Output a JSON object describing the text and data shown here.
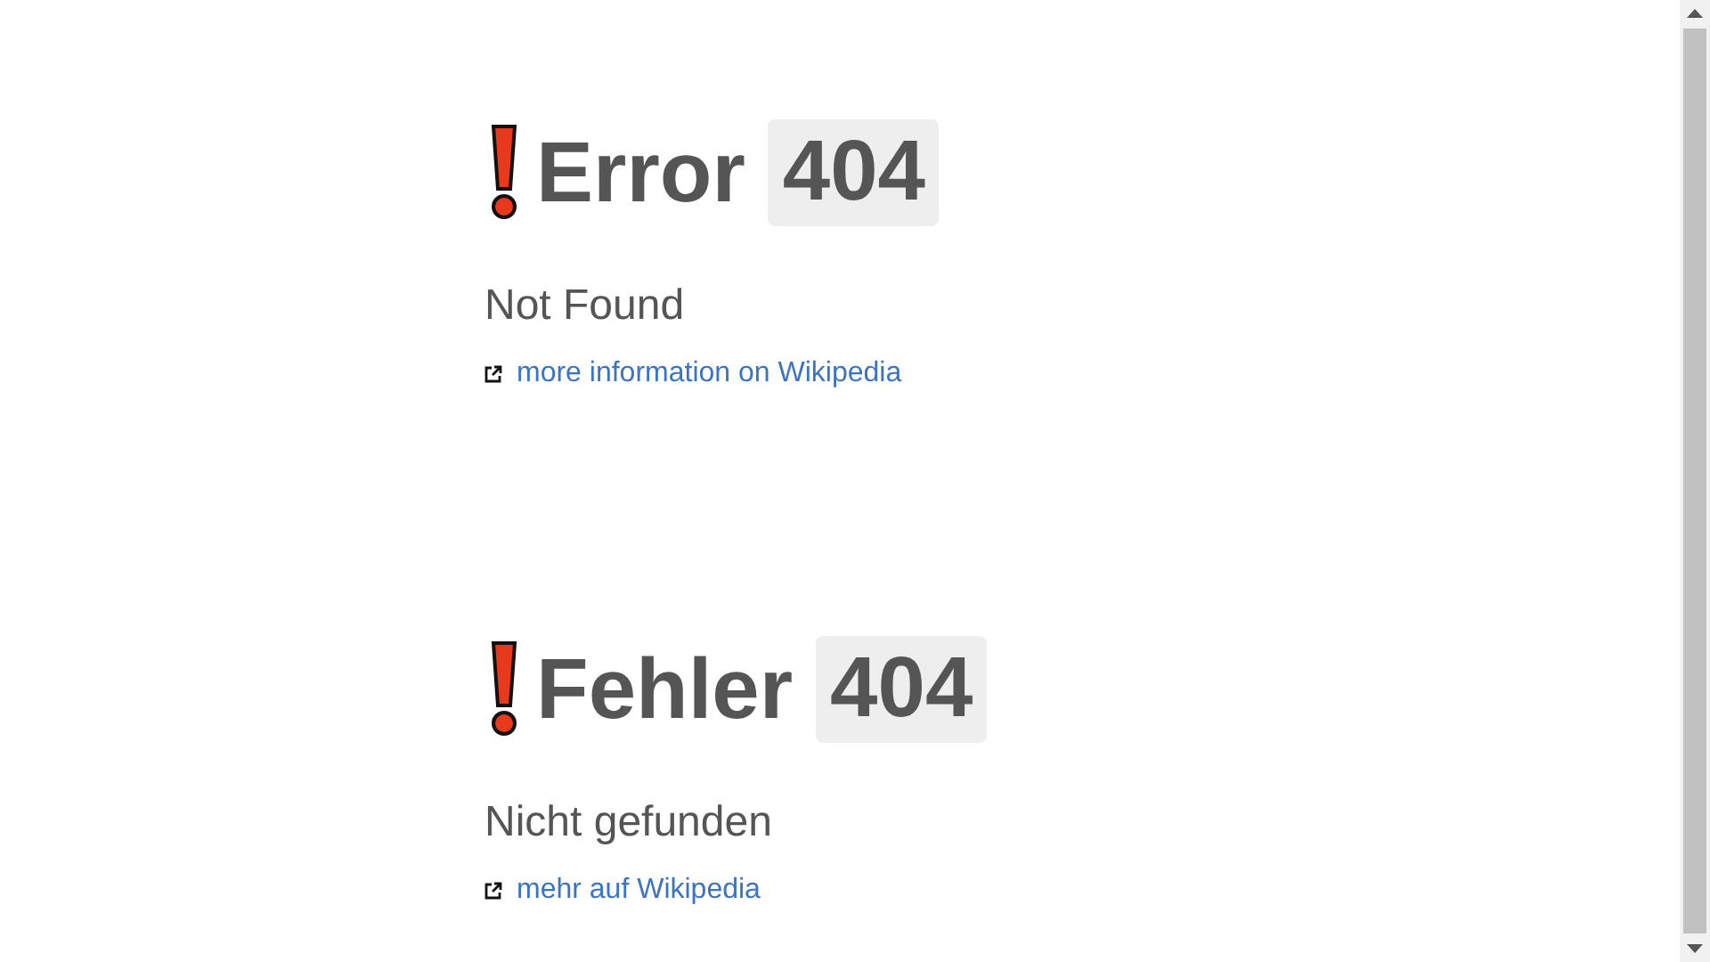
{
  "sections": [
    {
      "title": "Error",
      "code": "404",
      "message": "Not Found",
      "link": "more information on Wikipedia"
    },
    {
      "title": "Fehler",
      "code": "404",
      "message": "Nicht gefunden",
      "link": "mehr auf Wikipedia"
    }
  ]
}
